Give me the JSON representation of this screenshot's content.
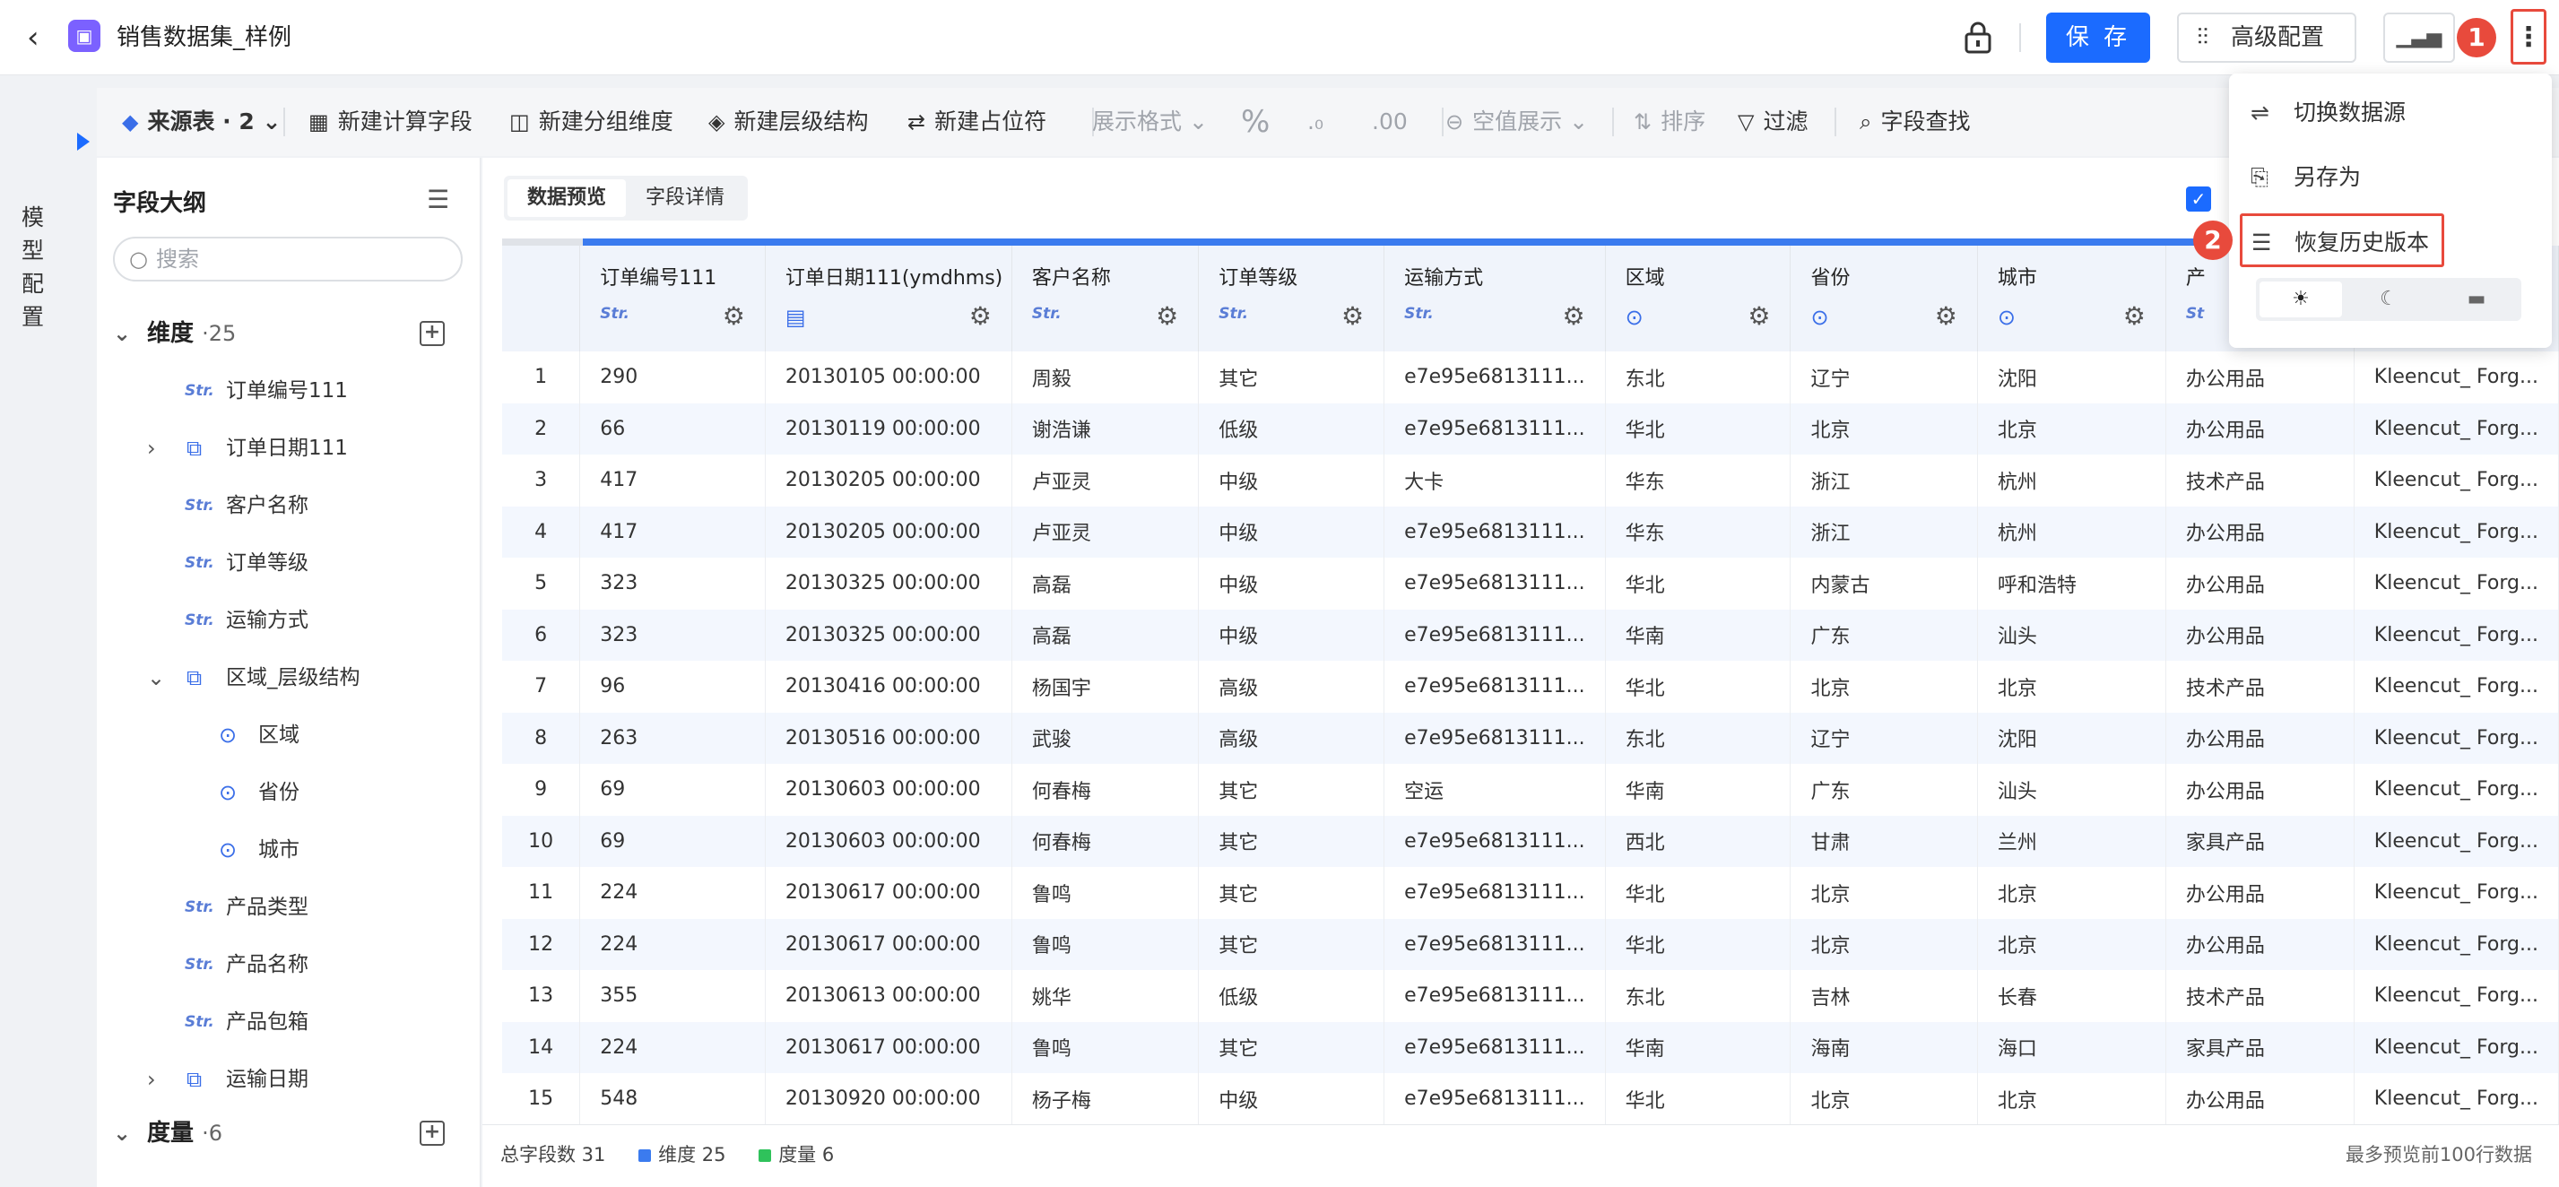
{
  "header": {
    "title": "销售数据集_样例",
    "save_label": "保 存",
    "advanced_label": "高级配置"
  },
  "left_rail": {
    "label": "模型配置"
  },
  "toolbar": {
    "source": "来源表 · 2",
    "items": [
      "新建计算字段",
      "新建分组维度",
      "新建层级结构",
      "新建占位符",
      "展示格式",
      "空值展示",
      "排序",
      "过滤",
      "字段查找"
    ]
  },
  "sidebar": {
    "title": "字段大纲",
    "search_placeholder": "搜索",
    "dimension_label": "维度",
    "dimension_count": "·25",
    "measure_label": "度量",
    "measure_count": "·6",
    "items": [
      {
        "type": "Str.",
        "label": "订单编号111"
      },
      {
        "type": "hier",
        "label": "订单日期111"
      },
      {
        "type": "Str.",
        "label": "客户名称"
      },
      {
        "type": "Str.",
        "label": "订单等级"
      },
      {
        "type": "Str.",
        "label": "运输方式"
      },
      {
        "type": "hier",
        "label": "区域_层级结构"
      },
      {
        "type": "geo",
        "label": "区域"
      },
      {
        "type": "geo",
        "label": "省份"
      },
      {
        "type": "geo",
        "label": "城市"
      },
      {
        "type": "Str.",
        "label": "产品类型"
      },
      {
        "type": "Str.",
        "label": "产品名称"
      },
      {
        "type": "Str.",
        "label": "产品包箱"
      },
      {
        "type": "hier",
        "label": "运输日期"
      }
    ]
  },
  "content": {
    "tabs": [
      "数据预览",
      "字段详情"
    ],
    "columns": [
      {
        "name": "订单编号111",
        "type": "Str."
      },
      {
        "name": "订单日期111(ymdhms)",
        "type": "date"
      },
      {
        "name": "客户名称",
        "type": "Str."
      },
      {
        "name": "订单等级",
        "type": "Str."
      },
      {
        "name": "运输方式",
        "type": "Str."
      },
      {
        "name": "区域",
        "type": "geo"
      },
      {
        "name": "省份",
        "type": "geo"
      },
      {
        "name": "城市",
        "type": "geo"
      },
      {
        "name": "产",
        "type": "St"
      },
      {
        "name": "",
        "type": ""
      }
    ],
    "rows": [
      [
        "1",
        "290",
        "20130105 00:00:00",
        "周毅",
        "其它",
        "e7e95e6813111...",
        "东北",
        "辽宁",
        "沈阳",
        "办公用品",
        "Kleencut_ Forg..."
      ],
      [
        "2",
        "66",
        "20130119 00:00:00",
        "谢浩谦",
        "低级",
        "e7e95e6813111...",
        "华北",
        "北京",
        "北京",
        "办公用品",
        "Kleencut_ Forg..."
      ],
      [
        "3",
        "417",
        "20130205 00:00:00",
        "卢亚灵",
        "中级",
        "大卡",
        "华东",
        "浙江",
        "杭州",
        "技术产品",
        "Kleencut_ Forg..."
      ],
      [
        "4",
        "417",
        "20130205 00:00:00",
        "卢亚灵",
        "中级",
        "e7e95e6813111...",
        "华东",
        "浙江",
        "杭州",
        "办公用品",
        "Kleencut_ Forg..."
      ],
      [
        "5",
        "323",
        "20130325 00:00:00",
        "高磊",
        "中级",
        "e7e95e6813111...",
        "华北",
        "内蒙古",
        "呼和浩特",
        "办公用品",
        "Kleencut_ Forg..."
      ],
      [
        "6",
        "323",
        "20130325 00:00:00",
        "高磊",
        "中级",
        "e7e95e6813111...",
        "华南",
        "广东",
        "汕头",
        "办公用品",
        "Kleencut_ Forg..."
      ],
      [
        "7",
        "96",
        "20130416 00:00:00",
        "杨国宇",
        "高级",
        "e7e95e6813111...",
        "华北",
        "北京",
        "北京",
        "技术产品",
        "Kleencut_ Forg..."
      ],
      [
        "8",
        "263",
        "20130516 00:00:00",
        "武骏",
        "高级",
        "e7e95e6813111...",
        "东北",
        "辽宁",
        "沈阳",
        "办公用品",
        "Kleencut_ Forg..."
      ],
      [
        "9",
        "69",
        "20130603 00:00:00",
        "何春梅",
        "其它",
        "空运",
        "华南",
        "广东",
        "汕头",
        "办公用品",
        "Kleencut_ Forg..."
      ],
      [
        "10",
        "69",
        "20130603 00:00:00",
        "何春梅",
        "其它",
        "e7e95e6813111...",
        "西北",
        "甘肃",
        "兰州",
        "家具产品",
        "Kleencut_ Forg..."
      ],
      [
        "11",
        "224",
        "20130617 00:00:00",
        "鲁鸣",
        "其它",
        "e7e95e6813111...",
        "华北",
        "北京",
        "北京",
        "办公用品",
        "Kleencut_ Forg..."
      ],
      [
        "12",
        "224",
        "20130617 00:00:00",
        "鲁鸣",
        "其它",
        "e7e95e6813111...",
        "华北",
        "北京",
        "北京",
        "办公用品",
        "Kleencut_ Forg..."
      ],
      [
        "13",
        "355",
        "20130613 00:00:00",
        "姚华",
        "低级",
        "e7e95e6813111...",
        "东北",
        "吉林",
        "长春",
        "技术产品",
        "Kleencut_ Forg..."
      ],
      [
        "14",
        "224",
        "20130617 00:00:00",
        "鲁鸣",
        "其它",
        "e7e95e6813111...",
        "华南",
        "海南",
        "海口",
        "家具产品",
        "Kleencut_ Forg..."
      ],
      [
        "15",
        "548",
        "20130920 00:00:00",
        "杨子梅",
        "中级",
        "e7e95e6813111...",
        "华北",
        "北京",
        "北京",
        "办公用品",
        "Kleencut_ Forg..."
      ]
    ]
  },
  "footer": {
    "total": "总字段数 31",
    "dimension": "维度 25",
    "measure": "度量 6",
    "note": "最多预览前100行数据"
  },
  "menu": {
    "items": [
      "切换数据源",
      "另存为",
      "恢复历史版本"
    ],
    "badge1": "1",
    "badge2": "2"
  },
  "colors": {
    "primary": "#1b6bff",
    "annotation": "#e84a3c",
    "dimension": "#3b7bef",
    "measure": "#2fc25b"
  }
}
